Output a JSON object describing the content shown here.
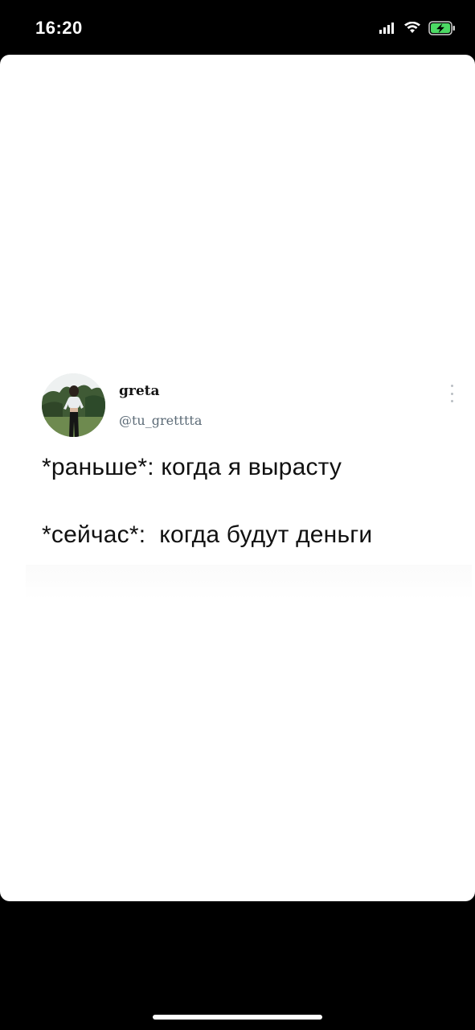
{
  "status_bar": {
    "time": "16:20",
    "icons": [
      "cellular-signal-icon",
      "wifi-icon",
      "battery-charging-icon"
    ],
    "battery_color": "#4cd964"
  },
  "tweet": {
    "display_name": "greta",
    "handle": "@tu_gretttta",
    "avatar": "profile-photo",
    "lines": [
      "*раньше*: когда я вырасту",
      "*сейчас*:  когда будут деньги"
    ]
  },
  "colors": {
    "background": "#000000",
    "sheet": "#ffffff",
    "text": "#111111",
    "handle": "#5b6a76"
  }
}
